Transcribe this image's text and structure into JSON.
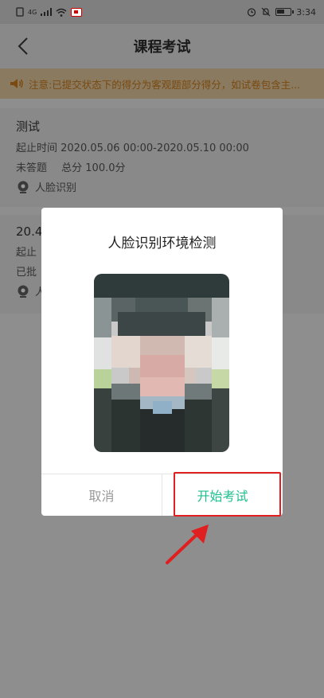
{
  "status_bar": {
    "network": "4G",
    "time": "3:34"
  },
  "header": {
    "title": "课程考试"
  },
  "notice": {
    "text": "注意:已提交状态下的得分为客观题部分得分，如试卷包含主..."
  },
  "exams": [
    {
      "title": "测试",
      "period": "起止时间 2020.05.06 00:00-2020.05.10 00:00",
      "status": "未答题",
      "total": "总分 100.0分",
      "face_label": "人脸识别"
    },
    {
      "title": "20.4",
      "period": "起止",
      "status": "已批",
      "face_label": "人"
    }
  ],
  "dialog": {
    "title": "人脸识别环境检测",
    "cancel_label": "取消",
    "start_label": "开始考试"
  },
  "colors": {
    "accent": "#1dbf8e",
    "highlight": "#e02020",
    "notice_text": "#7a4a10"
  }
}
